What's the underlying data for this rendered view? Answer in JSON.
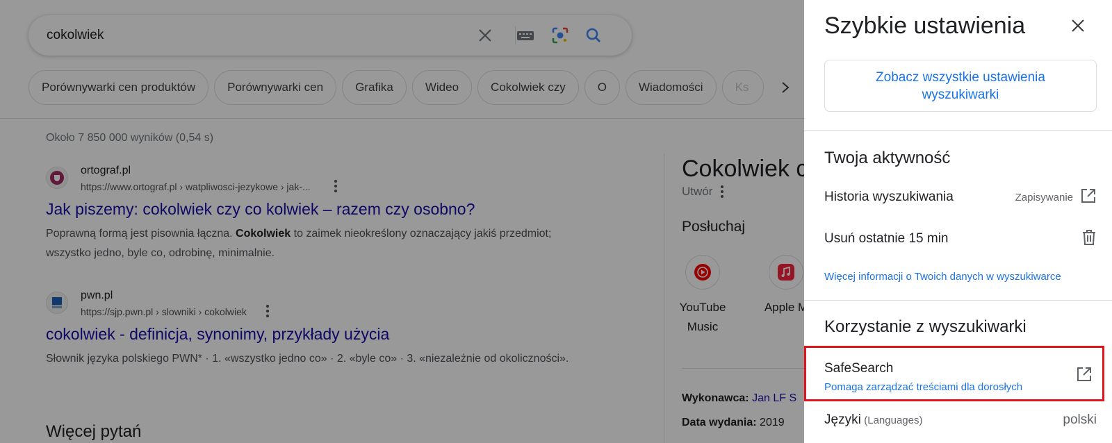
{
  "search": {
    "query": "cokolwiek"
  },
  "chips": [
    "Porównywarki cen produktów",
    "Porównywarki cen",
    "Grafika",
    "Wideo",
    "Cokolwiek czy",
    "O",
    "Wiadomości",
    "Ks"
  ],
  "stats": "Około 7 850 000 wyników (0,54 s)",
  "results": [
    {
      "site": "ortograf.pl",
      "url": "https://www.ortograf.pl › watpliwosci-jezykowe › jak-...",
      "title": "Jak piszemy: cokolwiek czy co kolwiek – razem czy osobno?",
      "snippet_a": "Poprawną formą jest pisownia łączna. ",
      "snippet_bold": "Cokolwiek",
      "snippet_b": " to zaimek nieokreślony oznaczający jakiś przedmiot; wszystko jedno, byle co, odrobinę, minimalnie."
    },
    {
      "site": "pwn.pl",
      "url": "https://sjp.pwn.pl › slowniki › cokolwiek",
      "title": "cokolwiek - definicja, synonimy, przykłady użycia",
      "snippet": "Słownik języka polskiego PWN* · 1. «wszystko jedno co» · 2. «byle co» · 3. «niezależnie od okoliczności»."
    }
  ],
  "more_questions": "Więcej pytań",
  "knowledge_panel": {
    "title": "Cokolwiek c",
    "subtitle": "Utwór",
    "listen": "Posłuchaj",
    "apps": [
      {
        "name": "YouTube Music",
        "icon": "youtube-music-icon"
      },
      {
        "name": "Apple M",
        "icon": "apple-music-icon"
      }
    ],
    "performer_label": "Wykonawca:",
    "performer_value": "Jan LF S",
    "release_label": "Data wydania:",
    "release_value": "2019"
  },
  "quick_settings": {
    "title": "Szybkie ustawienia",
    "all_settings": "Zobacz wszystkie ustawienia wyszukiwarki",
    "activity_heading": "Twoja aktywność",
    "history_label": "Historia wyszukiwania",
    "history_status": "Zapisywanie",
    "delete_label": "Usuń ostatnie 15 min",
    "data_link": "Więcej informacji o Twoich danych w wyszukiwarce",
    "usage_heading": "Korzystanie z wyszukiwarki",
    "safesearch_label": "SafeSearch",
    "safesearch_desc": "Pomaga zarządzać treściami dla dorosłych",
    "languages_label": "Języki",
    "languages_sub": "(Languages)",
    "languages_value": "polski"
  },
  "colors": {
    "link_blue": "#1a73e8",
    "result_title": "#1a0dab",
    "highlight_red": "#e0151d"
  }
}
